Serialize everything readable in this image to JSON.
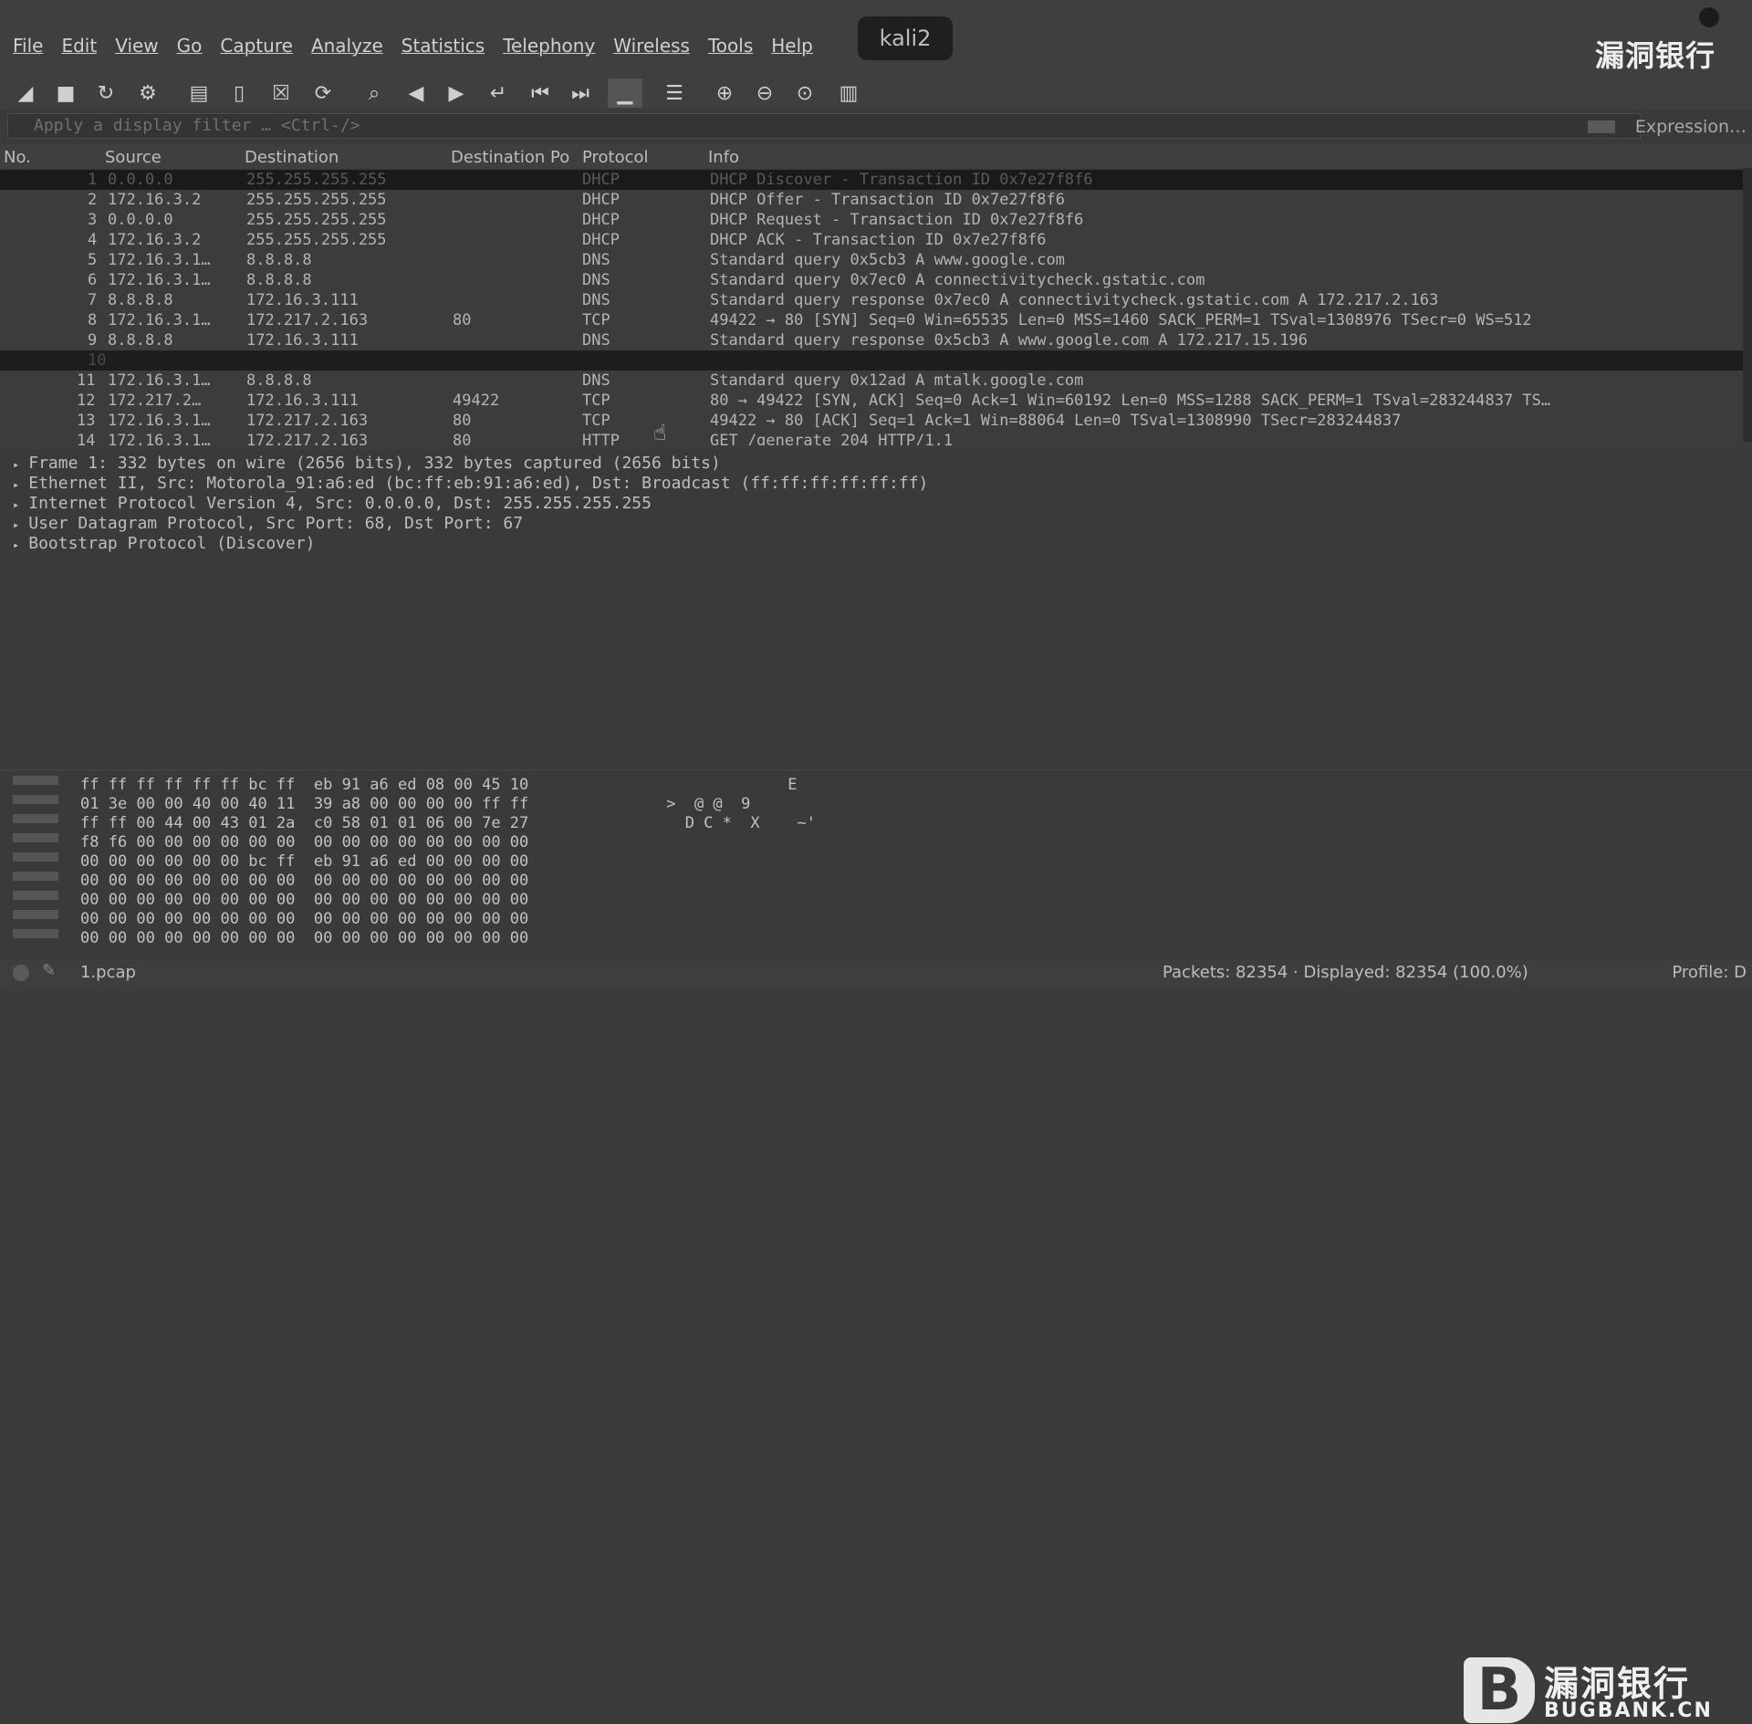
{
  "menubar": {
    "items": [
      "File",
      "Edit",
      "View",
      "Go",
      "Capture",
      "Analyze",
      "Statistics",
      "Telephony",
      "Wireless",
      "Tools",
      "Help"
    ]
  },
  "window_badge": "kali2",
  "watermark_top": "漏洞银行",
  "filter": {
    "placeholder": "Apply a display filter … <Ctrl-/>",
    "expression_label": "Expression…"
  },
  "packet_list": {
    "columns": [
      "No.",
      "Source",
      "Destination",
      "Destination Po",
      "Protocol",
      "Info"
    ],
    "rows": [
      {
        "no": "1",
        "src": "0.0.0.0",
        "dst": "255.255.255.255",
        "dport": "",
        "proto": "DHCP",
        "info": "DHCP Discover  - Transaction ID 0x7e27f8f6"
      },
      {
        "no": "2",
        "src": "172.16.3.2",
        "dst": "255.255.255.255",
        "dport": "",
        "proto": "DHCP",
        "info": "DHCP Offer     - Transaction ID 0x7e27f8f6"
      },
      {
        "no": "3",
        "src": "0.0.0.0",
        "dst": "255.255.255.255",
        "dport": "",
        "proto": "DHCP",
        "info": "DHCP Request   - Transaction ID 0x7e27f8f6"
      },
      {
        "no": "4",
        "src": "172.16.3.2",
        "dst": "255.255.255.255",
        "dport": "",
        "proto": "DHCP",
        "info": "DHCP ACK       - Transaction ID 0x7e27f8f6"
      },
      {
        "no": "5",
        "src": "172.16.3.1…",
        "dst": "8.8.8.8",
        "dport": "",
        "proto": "DNS",
        "info": "Standard query 0x5cb3 A www.google.com"
      },
      {
        "no": "6",
        "src": "172.16.3.1…",
        "dst": "8.8.8.8",
        "dport": "",
        "proto": "DNS",
        "info": "Standard query 0x7ec0 A connectivitycheck.gstatic.com"
      },
      {
        "no": "7",
        "src": "8.8.8.8",
        "dst": "172.16.3.111",
        "dport": "",
        "proto": "DNS",
        "info": "Standard query response 0x7ec0 A connectivitycheck.gstatic.com A 172.217.2.163"
      },
      {
        "no": "8",
        "src": "172.16.3.1…",
        "dst": "172.217.2.163",
        "dport": "80",
        "proto": "TCP",
        "info": "49422 → 80 [SYN] Seq=0 Win=65535 Len=0 MSS=1460 SACK_PERM=1 TSval=1308976 TSecr=0 WS=512"
      },
      {
        "no": "9",
        "src": "8.8.8.8",
        "dst": "172.16.3.111",
        "dport": "",
        "proto": "DNS",
        "info": "Standard query response 0x5cb3 A www.google.com A 172.217.15.196"
      },
      {
        "no": "10",
        "src": "",
        "dst": "",
        "dport": "",
        "proto": "",
        "info": ""
      },
      {
        "no": "11",
        "src": "172.16.3.1…",
        "dst": "8.8.8.8",
        "dport": "",
        "proto": "DNS",
        "info": "Standard query 0x12ad A mtalk.google.com"
      },
      {
        "no": "12",
        "src": "172.217.2…",
        "dst": "172.16.3.111",
        "dport": "49422",
        "proto": "TCP",
        "info": "80 → 49422 [SYN, ACK] Seq=0 Ack=1 Win=60192 Len=0 MSS=1288 SACK_PERM=1 TSval=283244837 TS…"
      },
      {
        "no": "13",
        "src": "172.16.3.1…",
        "dst": "172.217.2.163",
        "dport": "80",
        "proto": "TCP",
        "info": "49422 → 80 [ACK] Seq=1 Ack=1 Win=88064 Len=0 TSval=1308990 TSecr=283244837"
      },
      {
        "no": "14",
        "src": "172.16.3.1…",
        "dst": "172.217.2.163",
        "dport": "80",
        "proto": "HTTP",
        "info": "GET /generate_204 HTTP/1.1"
      }
    ]
  },
  "details": [
    "Frame 1: 332 bytes on wire (2656 bits), 332 bytes captured (2656 bits)",
    "Ethernet II, Src: Motorola_91:a6:ed (bc:ff:eb:91:a6:ed), Dst: Broadcast (ff:ff:ff:ff:ff:ff)",
    "Internet Protocol Version 4, Src: 0.0.0.0, Dst: 255.255.255.255",
    "User Datagram Protocol, Src Port: 68, Dst Port: 67",
    "Bootstrap Protocol (Discover)"
  ],
  "bytes": [
    {
      "hex": "ff ff ff ff ff ff bc ff  eb 91 a6 ed 08 00 45 10",
      "ascii": "              E"
    },
    {
      "hex": "01 3e 00 00 40 00 40 11  39 a8 00 00 00 00 ff ff",
      "ascii": " >  @ @  9"
    },
    {
      "hex": "ff ff 00 44 00 43 01 2a  c0 58 01 01 06 00 7e 27",
      "ascii": "   D C *  X    ~'"
    },
    {
      "hex": "f8 f6 00 00 00 00 00 00  00 00 00 00 00 00 00 00",
      "ascii": ""
    },
    {
      "hex": "00 00 00 00 00 00 bc ff  eb 91 a6 ed 00 00 00 00",
      "ascii": ""
    },
    {
      "hex": "00 00 00 00 00 00 00 00  00 00 00 00 00 00 00 00",
      "ascii": ""
    },
    {
      "hex": "00 00 00 00 00 00 00 00  00 00 00 00 00 00 00 00",
      "ascii": ""
    },
    {
      "hex": "00 00 00 00 00 00 00 00  00 00 00 00 00 00 00 00",
      "ascii": ""
    },
    {
      "hex": "00 00 00 00 00 00 00 00  00 00 00 00 00 00 00 00",
      "ascii": ""
    }
  ],
  "status": {
    "file": "1.pcap",
    "packets": "Packets: 82354 · Displayed: 82354 (100.0%)",
    "profile": "Profile: D"
  },
  "logo": {
    "cn": "漏洞银行",
    "en": "BUGBANK.CN"
  }
}
